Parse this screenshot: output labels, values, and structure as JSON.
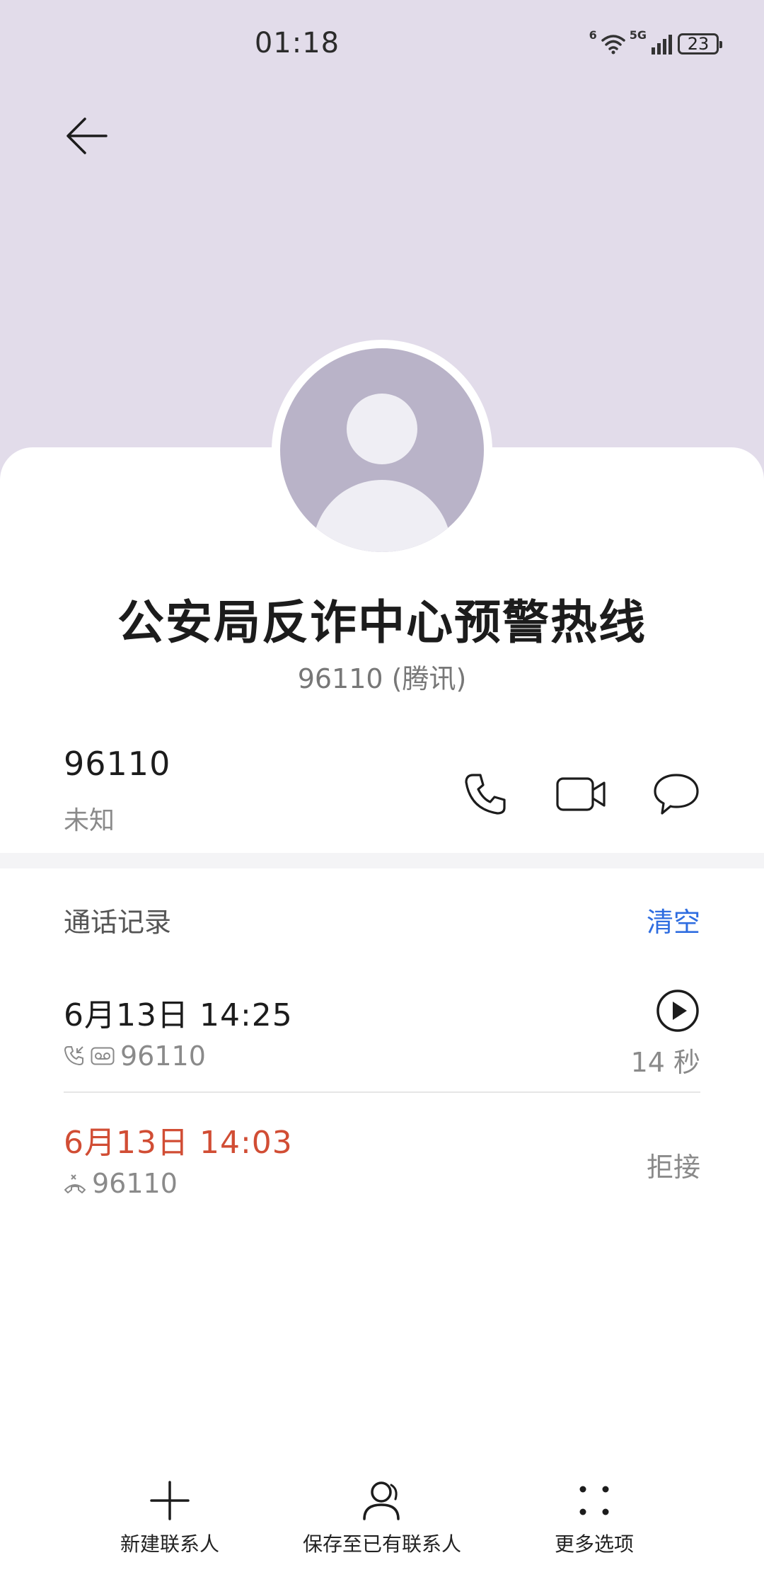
{
  "status_bar": {
    "time": "01:18",
    "wifi_badge": "6",
    "signal_badge": "5G",
    "battery": "23"
  },
  "contact": {
    "name": "公安局反诈中心预警热线",
    "subtitle": "96110 (腾讯)"
  },
  "phone": {
    "number": "96110",
    "type": "未知"
  },
  "calls": {
    "title": "通话记录",
    "clear_label": "清空",
    "items": [
      {
        "time": "6月13日 14:25",
        "number": "96110",
        "duration": "14 秒",
        "missed": false
      },
      {
        "time": "6月13日 14:03",
        "number": "96110",
        "status": "拒接",
        "missed": true
      }
    ]
  },
  "bottom_actions": {
    "new_contact": "新建联系人",
    "save_existing": "保存至已有联系人",
    "more": "更多选项"
  },
  "colors": {
    "header_bg": "#e2dcea",
    "accent_blue": "#2f6de0",
    "missed_red": "#d14d34"
  },
  "icons": {
    "back": "arrow-left-icon",
    "call": "phone-icon",
    "video": "video-camera-icon",
    "message": "message-bubble-icon",
    "play": "play-icon",
    "add": "plus-icon",
    "person": "person-icon",
    "more": "dots-grid-icon"
  }
}
